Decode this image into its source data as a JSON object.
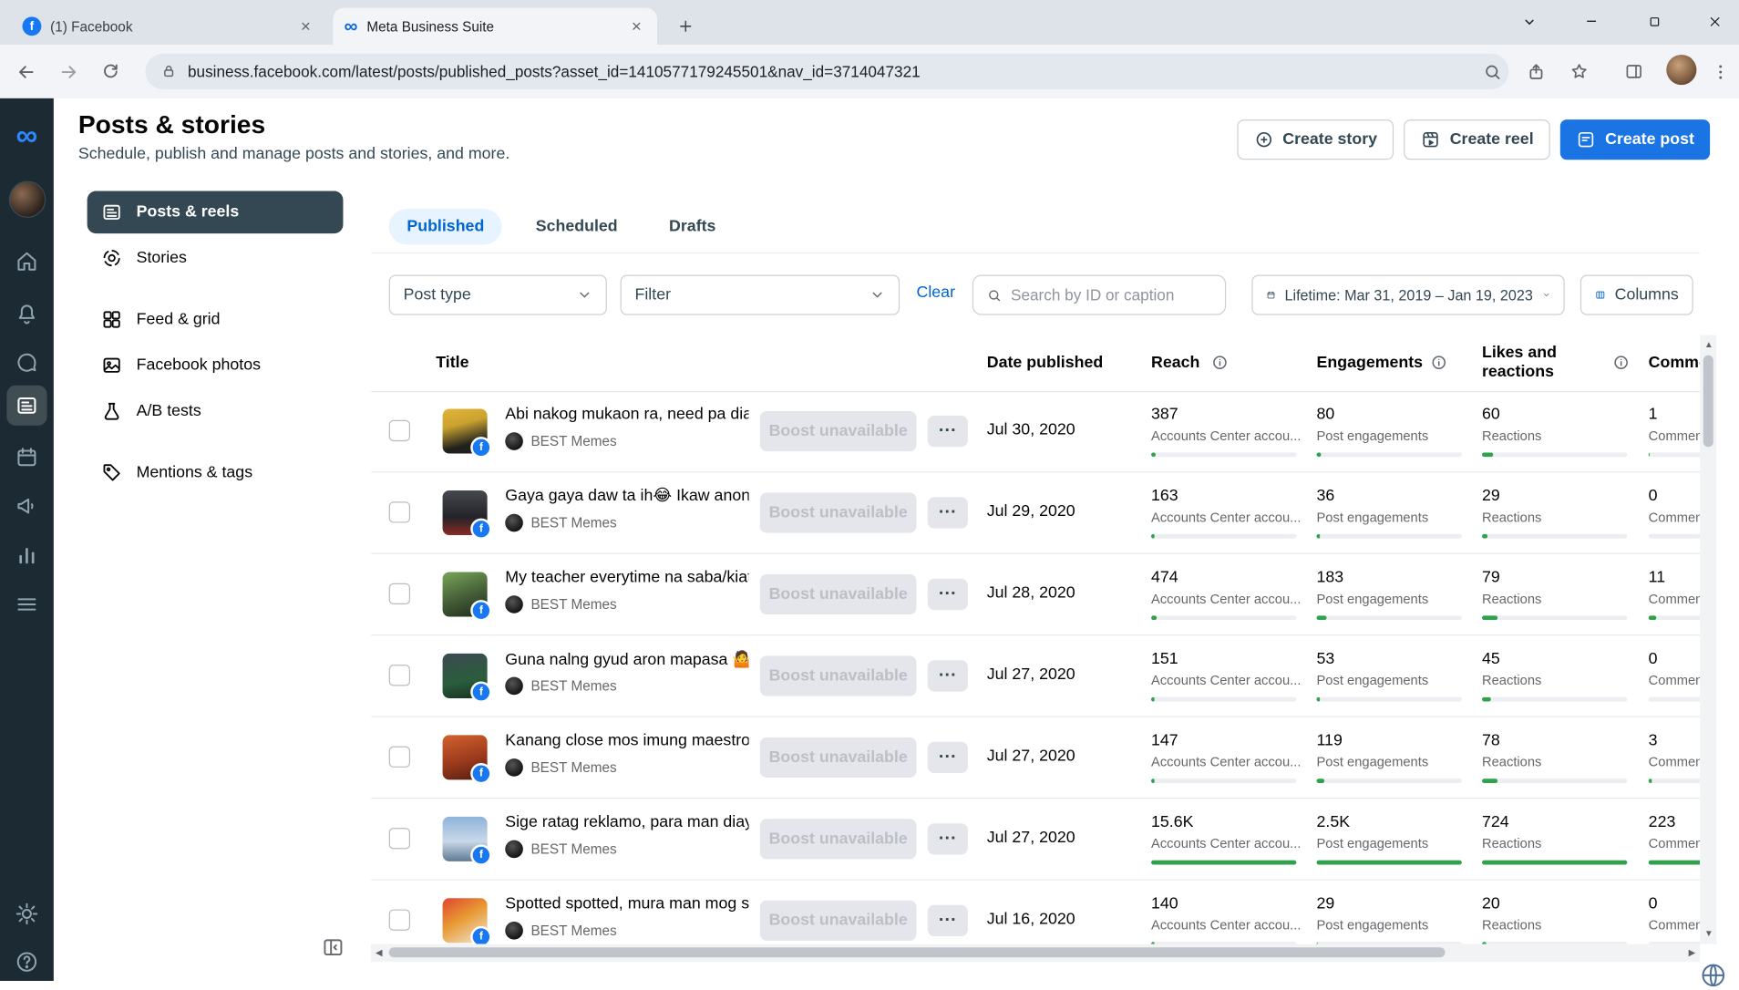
{
  "browser": {
    "tab1": "(1) Facebook",
    "tab2": "Meta Business Suite",
    "url": "business.facebook.com/latest/posts/published_posts?asset_id=1410577179245501&nav_id=3714047321"
  },
  "header": {
    "title": "Posts & stories",
    "subtitle": "Schedule, publish and manage posts and stories, and more.",
    "buttons": {
      "create_story": "Create story",
      "create_reel": "Create reel",
      "create_post": "Create post"
    }
  },
  "sidebar": {
    "items": [
      {
        "label": "Posts & reels"
      },
      {
        "label": "Stories"
      },
      {
        "label": "Feed & grid"
      },
      {
        "label": "Facebook photos"
      },
      {
        "label": "A/B tests"
      },
      {
        "label": "Mentions & tags"
      }
    ]
  },
  "tabs": {
    "published": "Published",
    "scheduled": "Scheduled",
    "drafts": "Drafts"
  },
  "filters": {
    "post_type": "Post type",
    "filter": "Filter",
    "clear": "Clear",
    "search_placeholder": "Search by ID or caption",
    "date_range": "Lifetime: Mar 31, 2019 – Jan 19, 2023",
    "columns": "Columns"
  },
  "table": {
    "headers": {
      "title": "Title",
      "date": "Date published",
      "reach": "Reach",
      "engagements": "Engagements",
      "likes": "Likes and reactions",
      "comments": "Comments"
    },
    "boost_label": "Boost unavailable",
    "more_label": "...",
    "sub_labels": {
      "reach": "Accounts Center accou...",
      "engagements": "Post engagements",
      "likes": "Reactions",
      "comments": "Commen..."
    },
    "rows": [
      {
        "title": "Abi nakog mukaon ra, need pa dia...",
        "page": "BEST Memes",
        "date": "Jul 30, 2020",
        "reach": "387",
        "engagements": "80",
        "likes": "60",
        "comments": "1",
        "reach_bar": 3,
        "eng_bar": 3,
        "likes_bar": 8,
        "comments_bar": 1,
        "thumb": "linear-gradient(165deg,#e3b53a 0%,#caa22f 35%,#20201e 75%)"
      },
      {
        "title": "Gaya gaya daw ta ih😂 Ikaw anon...",
        "page": "BEST Memes",
        "date": "Jul 29, 2020",
        "reach": "163",
        "engagements": "36",
        "likes": "29",
        "comments": "0",
        "reach_bar": 2,
        "eng_bar": 2,
        "likes_bar": 4,
        "comments_bar": 0,
        "thumb": "linear-gradient(180deg,#46494f 0%,#23242a 60%,#8a2b24 100%)"
      },
      {
        "title": "My teacher everytime na saba/kiat...",
        "page": "BEST Memes",
        "date": "Jul 28, 2020",
        "reach": "474",
        "engagements": "183",
        "likes": "79",
        "comments": "11",
        "reach_bar": 4,
        "eng_bar": 7,
        "likes_bar": 11,
        "comments_bar": 5,
        "thumb": "linear-gradient(160deg,#7aa65a 0%,#435c36 55%,#1e2a1a 100%)"
      },
      {
        "title": "Guna nalng gyud aron mapasa 🤷",
        "page": "BEST Memes",
        "date": "Jul 27, 2020",
        "reach": "151",
        "engagements": "53",
        "likes": "45",
        "comments": "0",
        "reach_bar": 2,
        "eng_bar": 2,
        "likes_bar": 6,
        "comments_bar": 0,
        "thumb": "linear-gradient(170deg,#3c4a52 0%,#2a5d3c 60%,#17301f 100%)"
      },
      {
        "title": "Kanang close mos imung maestro...",
        "page": "BEST Memes",
        "date": "Jul 27, 2020",
        "reach": "147",
        "engagements": "119",
        "likes": "78",
        "comments": "3",
        "reach_bar": 2,
        "eng_bar": 5,
        "likes_bar": 11,
        "comments_bar": 2,
        "thumb": "linear-gradient(165deg,#d2622e 0%,#9c3a1d 55%,#521d10 100%)"
      },
      {
        "title": "Sige ratag reklamo, para man diay...",
        "page": "BEST Memes",
        "date": "Jul 27, 2020",
        "reach": "15.6K",
        "engagements": "2.5K",
        "likes": "724",
        "comments": "223",
        "reach_bar": 100,
        "eng_bar": 100,
        "likes_bar": 100,
        "comments_bar": 100,
        "thumb": "linear-gradient(180deg,#8fb3d9 0%,#c8d8e8 55%,#5f7a94 100%)"
      },
      {
        "title": "Spotted spotted, mura man mog s...",
        "page": "BEST Memes",
        "date": "Jul 16, 2020",
        "reach": "140",
        "engagements": "29",
        "likes": "20",
        "comments": "0",
        "reach_bar": 2,
        "eng_bar": 1,
        "likes_bar": 3,
        "comments_bar": 0,
        "thumb": "linear-gradient(150deg,#e0452f 0%,#e89a33 45%,#f0e8d8 100%)"
      }
    ]
  },
  "colors": {
    "accent_blue": "#1b74e4",
    "link_blue": "#0064d1",
    "bar_green": "#31a24c",
    "sidebar_dark": "#1c2b33"
  }
}
